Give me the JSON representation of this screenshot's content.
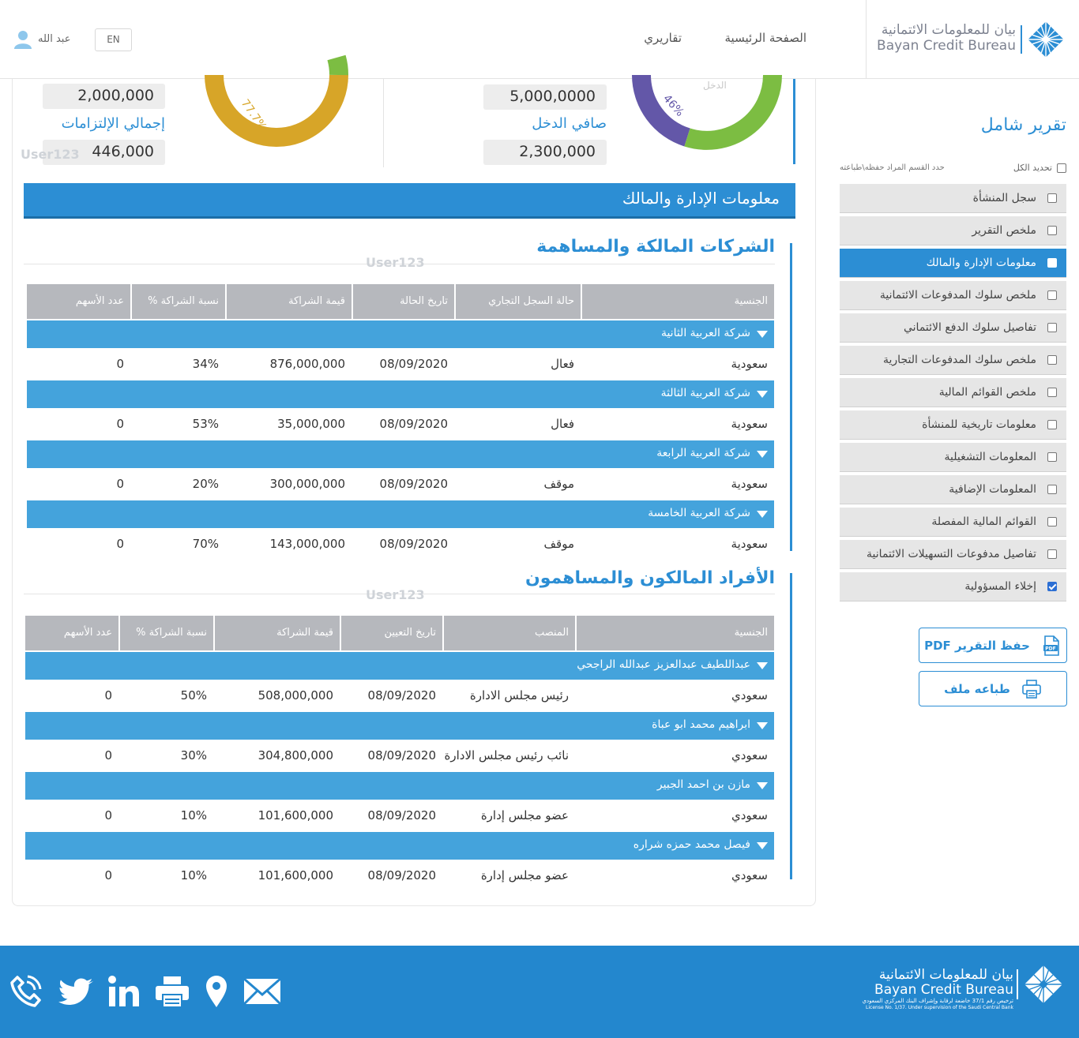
{
  "header": {
    "logo_ar": "بيان للمعلومات الائتمانية",
    "logo_en": "Bayan Credit Bureau",
    "nav": {
      "home": "الصفحة الرئيسية",
      "reports": "تقاريري"
    },
    "lang": "EN",
    "user": "عبد الله"
  },
  "summary": {
    "left": {
      "top_value": "2,000,000",
      "label": "إجمالي الإلتزامات",
      "value": "446,000",
      "donut_pct": "77.7%",
      "donut_fraction": 0.777
    },
    "right": {
      "top_value": "5,000,0000",
      "label": "صافي الدخل",
      "value": "2,300,000",
      "donut_pct": "46%",
      "donut_fraction": 0.46,
      "donut_caption": "الدخل"
    },
    "watermark": "User123"
  },
  "section": {
    "title": "معلومات الإدارة والمالك"
  },
  "companies": {
    "title": "الشركات المالكة والمساهمة",
    "watermark": "User123",
    "headers": [
      "الجنسية",
      "حالة السجل التجاري",
      "تاريخ الحالة",
      "قيمة الشراكة",
      "نسبة الشراكة %",
      "عدد الأسهم"
    ],
    "groups": [
      {
        "name": "شركة العربية الثانية",
        "row": [
          "سعودية",
          "فعال",
          "08/09/2020",
          "876,000,000",
          "34%",
          "0"
        ]
      },
      {
        "name": "شركة العربية الثالثة",
        "row": [
          "سعودية",
          "فعال",
          "08/09/2020",
          "35,000,000",
          "53%",
          "0"
        ]
      },
      {
        "name": "شركة العربية الرابعة",
        "row": [
          "سعودية",
          "موقف",
          "08/09/2020",
          "300,000,000",
          "20%",
          "0"
        ]
      },
      {
        "name": "شركة العربية الخامسة",
        "row": [
          "سعودية",
          "موقف",
          "08/09/2020",
          "143,000,000",
          "70%",
          "0"
        ]
      }
    ]
  },
  "individuals": {
    "title": "الأفراد المالكون والمساهمون",
    "watermark": "User123",
    "headers": [
      "الجنسية",
      "المنصب",
      "تاريخ التعيين",
      "قيمة الشراكة",
      "نسبة الشراكة %",
      "عدد الأسهم"
    ],
    "groups": [
      {
        "name": "عبداللطيف عبدالعزيز عبدالله الراجحي",
        "row": [
          "سعودي",
          "رئيس مجلس الادارة",
          "08/09/2020",
          "508,000,000",
          "50%",
          "0"
        ]
      },
      {
        "name": "ابراهيم محمد ابو عباة",
        "row": [
          "سعودي",
          "نائب رئيس مجلس الادارة",
          "08/09/2020",
          "304,800,000",
          "30%",
          "0"
        ]
      },
      {
        "name": "مازن بن احمد الجبير",
        "row": [
          "سعودي",
          "عضو مجلس إدارة",
          "08/09/2020",
          "101,600,000",
          "10%",
          "0"
        ]
      },
      {
        "name": "فيصل محمد حمزه شراره",
        "row": [
          "سعودي",
          "عضو مجلس إدارة",
          "08/09/2020",
          "101,600,000",
          "10%",
          "0"
        ]
      }
    ]
  },
  "sidebar": {
    "title": "تقرير شامل",
    "select_all": "تحديد الكل",
    "hint": "حدد القسم المراد حفظه\\طباعته",
    "items": [
      {
        "label": "سجل المنشأة",
        "checked": false,
        "active": false
      },
      {
        "label": "ملخص التقرير",
        "checked": false,
        "active": false
      },
      {
        "label": "معلومات الإدارة والمالك",
        "checked": false,
        "active": true
      },
      {
        "label": "ملخص سلوك المدفوعات الائتمانية",
        "checked": false,
        "active": false
      },
      {
        "label": "تفاصيل سلوك الدفع الائتماني",
        "checked": false,
        "active": false
      },
      {
        "label": "ملخص سلوك المدفوعات التجارية",
        "checked": false,
        "active": false
      },
      {
        "label": "ملخص القوائم المالية",
        "checked": false,
        "active": false
      },
      {
        "label": "معلومات تاريخية للمنشأة",
        "checked": false,
        "active": false
      },
      {
        "label": "المعلومات التشغيلية",
        "checked": false,
        "active": false
      },
      {
        "label": "المعلومات الإضافية",
        "checked": false,
        "active": false
      },
      {
        "label": "القوائم المالية المفصلة",
        "checked": false,
        "active": false
      },
      {
        "label": "تفاصيل مدفوعات التسهيلات الائتمانية",
        "checked": false,
        "active": false
      },
      {
        "label": "إخلاء المسؤولية",
        "checked": true,
        "active": false
      }
    ],
    "save_pdf": "حفظ التقرير PDF",
    "print": "طباعه ملف"
  },
  "footer": {
    "logo_ar": "بيان للمعلومات الائتمانية",
    "logo_en": "Bayan Credit Bureau",
    "license_ar": "ترخيص رقم 37/1 خاضعة لرقابة وإشراف البنك المركزي السعودي",
    "license_en": "License No. 1/37. Under supervision of the Saudi Central Bank",
    "icons": [
      "email-icon",
      "location-icon",
      "print-icon",
      "linkedin-icon",
      "twitter-icon",
      "phone-icon"
    ]
  },
  "colors": {
    "primary": "#2c8ed4",
    "group_row": "#44a3dc",
    "header_cell": "#b6b8bd",
    "donut_gold": "#d7a528",
    "donut_green": "#7cbd42",
    "donut_purple": "#6357a8",
    "footer": "#2387ce"
  }
}
